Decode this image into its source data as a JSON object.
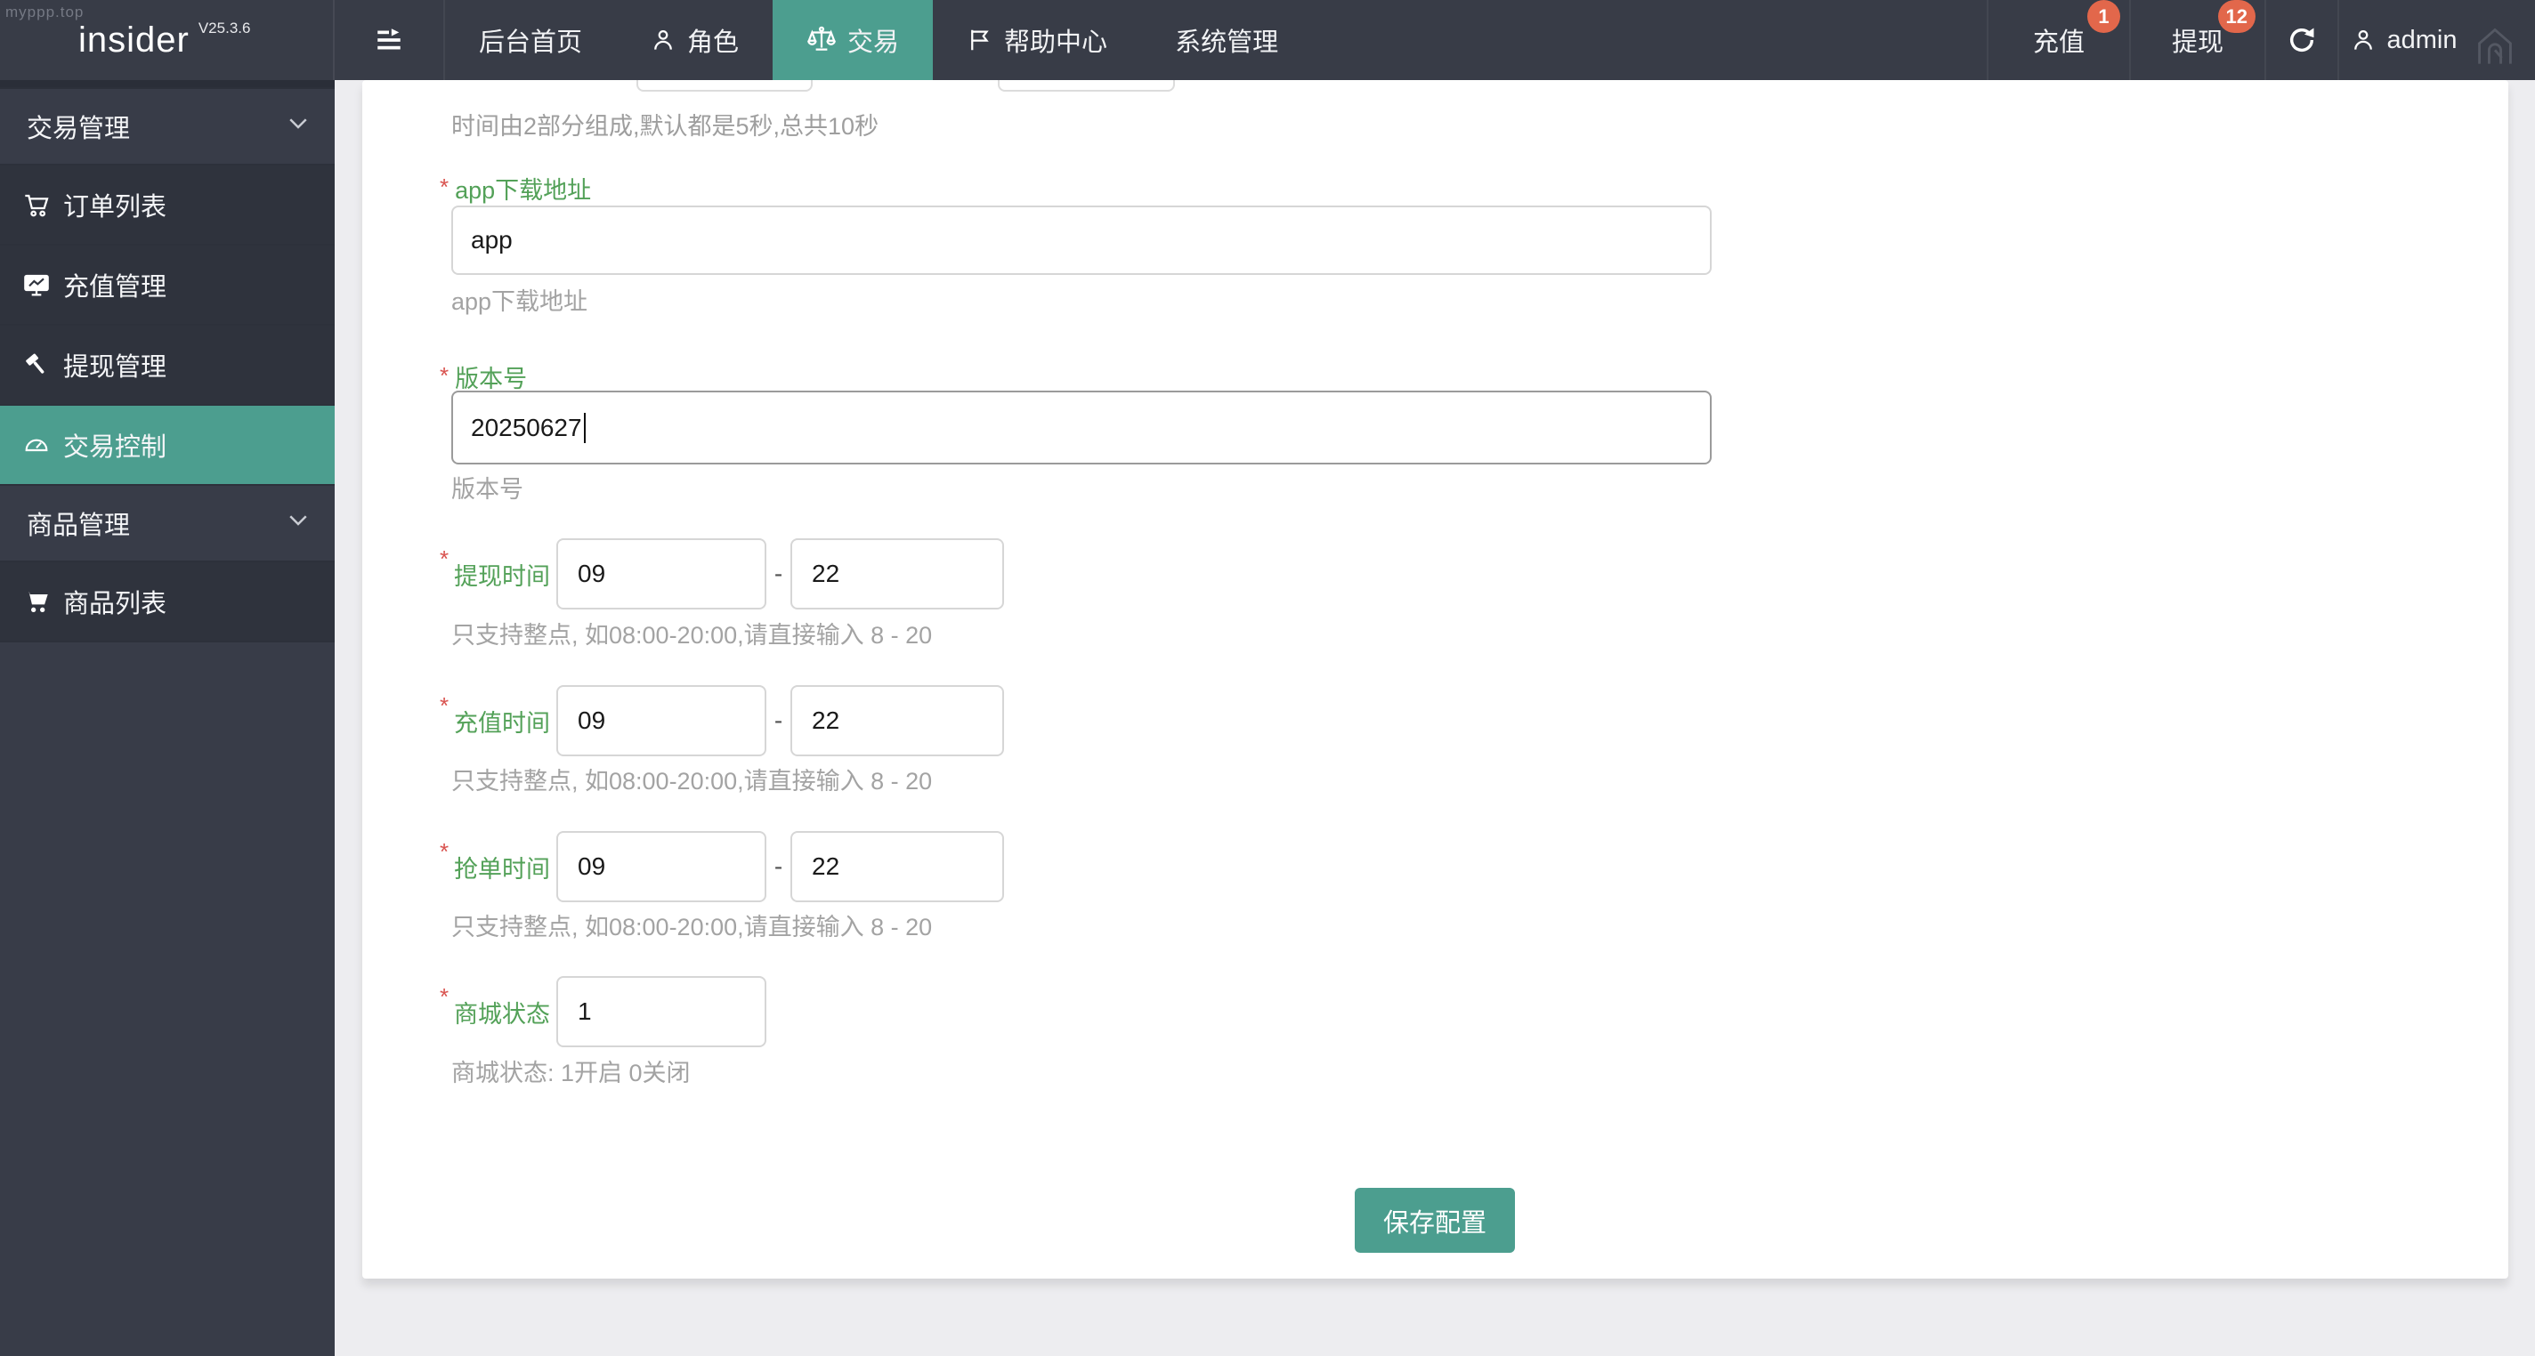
{
  "watermark": "myppp.top",
  "navbar": {
    "logo": "insider",
    "version": "V25.3.6",
    "items": [
      {
        "label": "后台首页"
      },
      {
        "label": "角色"
      },
      {
        "label": "交易"
      },
      {
        "label": "帮助中心"
      },
      {
        "label": "系统管理"
      }
    ],
    "active_item": "交易",
    "recharge": {
      "label": "充值",
      "badge": "1"
    },
    "withdraw": {
      "label": "提现",
      "badge": "12"
    },
    "user": "admin",
    "accent_color": "#4c9e8f",
    "badge_color": "#e2674b"
  },
  "sidebar": {
    "rows": [
      {
        "label": "交易管理",
        "type": "header"
      },
      {
        "label": "订单列表",
        "type": "item"
      },
      {
        "label": "充值管理",
        "type": "item"
      },
      {
        "label": "提现管理",
        "type": "item"
      },
      {
        "label": "交易控制",
        "type": "item",
        "active": true
      },
      {
        "label": "商品管理",
        "type": "header"
      },
      {
        "label": "商品列表",
        "type": "item"
      }
    ],
    "active_color": "#4c9e8f"
  },
  "form": {
    "scroll_hint": "时间由2部分组成,默认都是5秒,总共10秒",
    "app_field": {
      "label": "app下载地址",
      "value": "app",
      "helper": "app下载地址"
    },
    "version_field": {
      "label": "版本号",
      "value": "20250627",
      "helper": "版本号"
    },
    "time_fields": [
      {
        "label": "提现时间",
        "from": "09",
        "to": "22",
        "helper": "只支持整点, 如08:00-20:00,请直接输入 8 - 20"
      },
      {
        "label": "充值时间",
        "from": "09",
        "to": "22",
        "helper": "只支持整点, 如08:00-20:00,请直接输入 8 - 20"
      },
      {
        "label": "抢单时间",
        "from": "09",
        "to": "22",
        "helper": "只支持整点, 如08:00-20:00,请直接输入 8 - 20"
      }
    ],
    "status_field": {
      "label": "商城状态",
      "value": "1",
      "helper": "商城状态: 1开启 0关闭"
    },
    "dash": "-",
    "required_mark": "*",
    "save_label": "保存配置",
    "label_color": "#53a158"
  }
}
